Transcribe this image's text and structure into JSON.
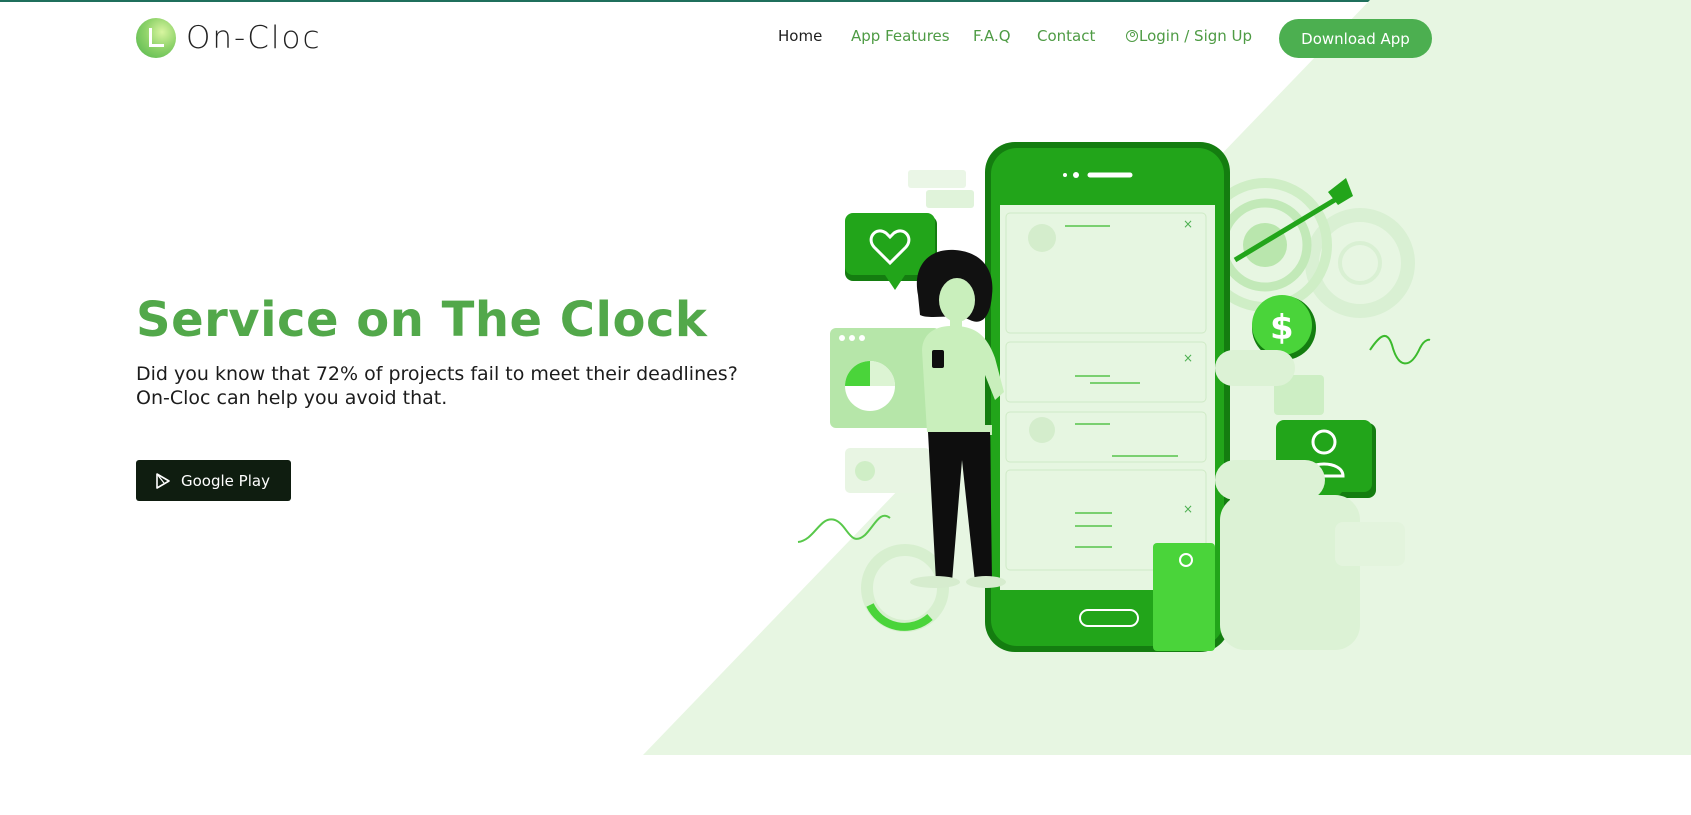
{
  "brand": {
    "name": "On-Cloc",
    "logo_icon": "logo-l-mark-icon"
  },
  "nav": {
    "items": [
      {
        "label": "Home",
        "active": true
      },
      {
        "label": "App Features"
      },
      {
        "label": "F.A.Q"
      },
      {
        "label": "Contact"
      },
      {
        "label": "Login / Sign Up",
        "icon": "user-circle-icon"
      }
    ],
    "download_label": "Download App"
  },
  "hero": {
    "title": "Service on The Clock",
    "subtitle": "Did you know that 72% of projects fail to meet their deadlines? On-Cloc can help you avoid that.",
    "cta_label": "Google Play",
    "cta_icon": "google-play-icon"
  },
  "colors": {
    "brand_green": "#52a84a",
    "button_green": "#4caf50",
    "light_green_bg": "#e6f5e1",
    "dark_button": "#0f1d10",
    "phone_green": "#22a51a"
  }
}
